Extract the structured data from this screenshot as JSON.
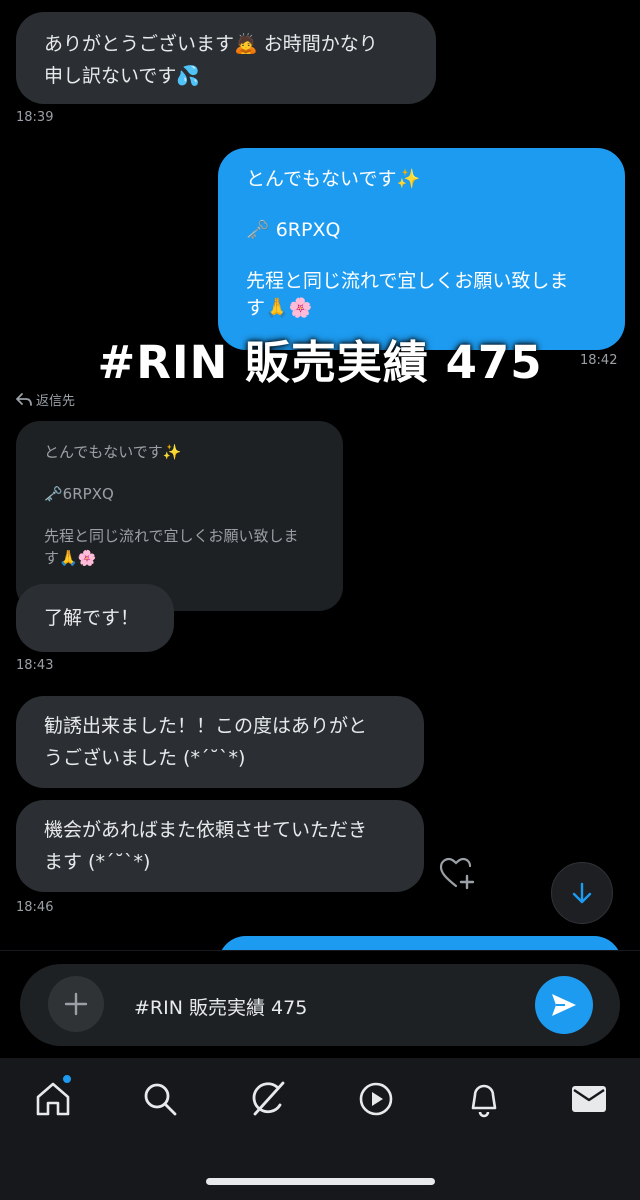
{
  "messages": [
    {
      "type": "received",
      "lines": [
        "ありがとうございます🙇 お時間かなり",
        "申し訳ないです💦"
      ],
      "time": "18:39"
    },
    {
      "type": "sent",
      "lines": [
        "とんでもないです✨",
        "",
        "🗝️ 6RPXQ",
        "",
        "先程と同じ流れで宜しくお願い致しま",
        "す🙏🌸"
      ],
      "time": "18:42"
    }
  ],
  "overlay_title": "#RIN 販売実績 475",
  "reply": {
    "label": "返信先",
    "quoted_lines": [
      "とんでもないです✨",
      "",
      "🗝️6RPXQ",
      "",
      "先程と同じ流れで宜しくお願い致しま",
      "す🙏🌸"
    ]
  },
  "reply_message": {
    "text": "了解です！",
    "time": "18:43"
  },
  "later_messages": [
    {
      "lines": [
        "勧誘出来ました！！この度はありがと",
        "うございました (*´˘`*)"
      ]
    },
    {
      "lines": [
        "機会があればまた依頼させていただき",
        "ます (*´˘`*)"
      ]
    }
  ],
  "later_time": "18:46",
  "composer": {
    "text": "#RIN 販売実績 475"
  },
  "tabs": [
    "home-icon",
    "search-icon",
    "grok-icon",
    "video-icon",
    "notifications-icon",
    "messages-icon"
  ],
  "colors": {
    "accent": "#1d9bf0",
    "bubble_received": "#2b2f33",
    "background": "#000000"
  }
}
